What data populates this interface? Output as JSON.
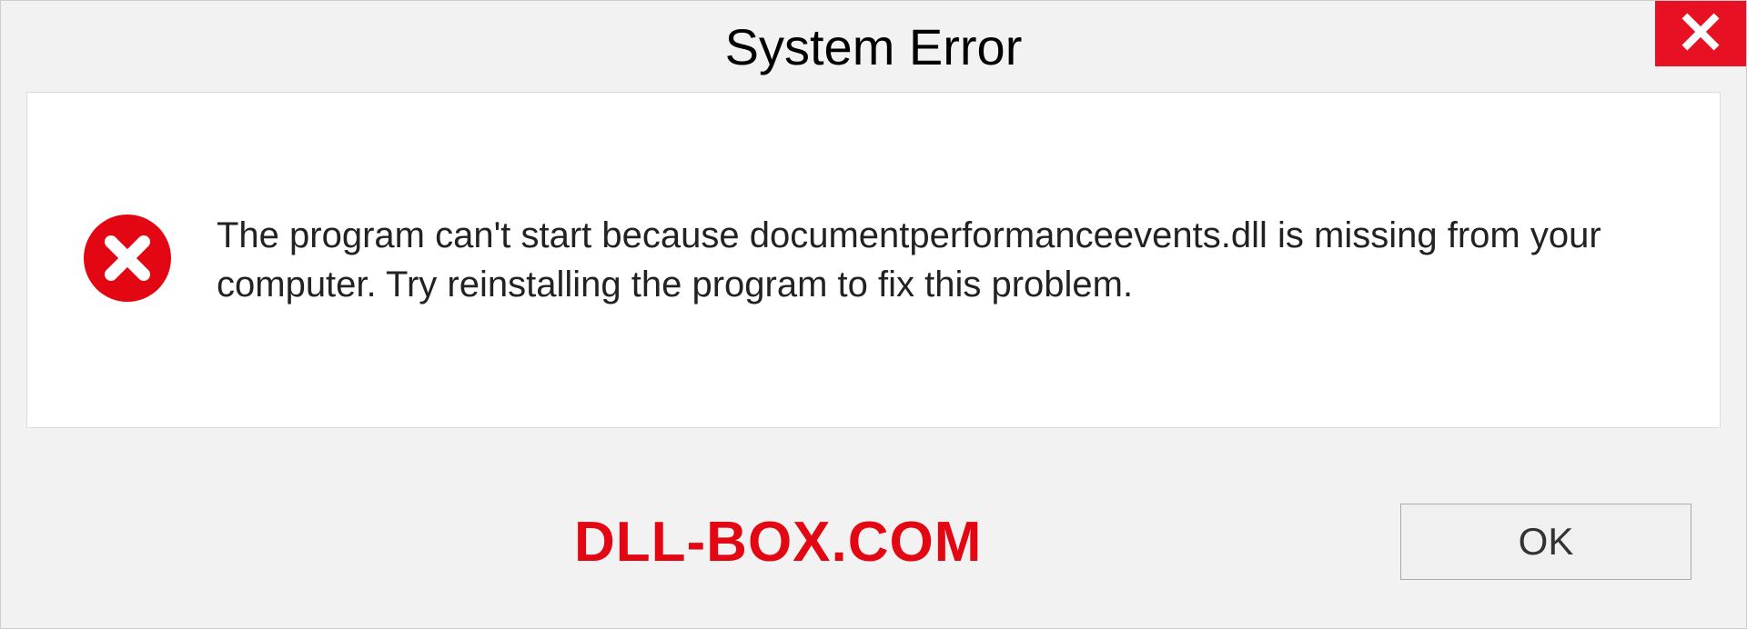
{
  "dialog": {
    "title": "System Error",
    "message": "The program can't start because documentperformanceevents.dll is missing from your computer. Try reinstalling the program to fix this problem.",
    "ok_label": "OK"
  },
  "watermark": "DLL-BOX.COM"
}
